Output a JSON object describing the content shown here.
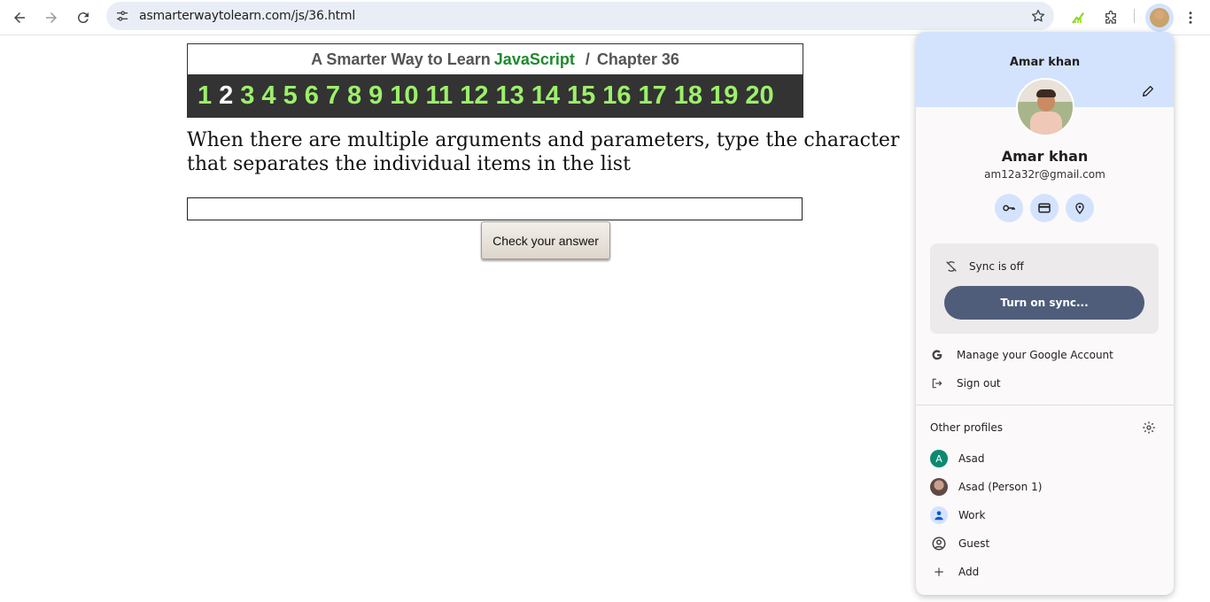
{
  "browser": {
    "url": "asmarterwaytolearn.com/js/36.html",
    "icons": {
      "back": "arrow-left-icon",
      "forward": "arrow-right-icon",
      "reload": "reload-icon",
      "site_info": "tune-icon",
      "bookmark": "star-icon",
      "extension_1": "green-chart-icon",
      "extensions": "puzzle-icon",
      "menu": "three-dots-icon"
    }
  },
  "page": {
    "title_prefix": "A Smarter Way to Learn",
    "title_js": "JavaScript",
    "title_sep": "/",
    "title_chapter": "Chapter 36",
    "numbers": [
      "1",
      "2",
      "3",
      "4",
      "5",
      "6",
      "7",
      "8",
      "9",
      "10",
      "11",
      "12",
      "13",
      "14",
      "15",
      "16",
      "17",
      "18",
      "19",
      "20"
    ],
    "current_number": "2",
    "question": "When there are multiple arguments and parameters, type the character that separates the individual items in the list",
    "answer_value": "",
    "check_button": "Check your answer",
    "colors": {
      "number": "#9cf06a",
      "current_number": "#ffffff",
      "bar_bg": "#333333",
      "js_green": "#1e8a2e"
    }
  },
  "profile_popup": {
    "name_top": "Amar khan",
    "name": "Amar khan",
    "email": "am12a32r@gmail.com",
    "quick_icons": [
      "key-icon",
      "credit-card-icon",
      "location-pin-icon"
    ],
    "sync_status": "Sync is off",
    "sync_button": "Turn on sync...",
    "manage_account": "Manage your Google Account",
    "sign_out": "Sign out",
    "other_profiles_title": "Other profiles",
    "profiles": [
      {
        "name": "Asad",
        "avatar_letter": "A",
        "color": "#0b8a6f"
      },
      {
        "name": "Asad (Person 1)",
        "avatar_letter": "",
        "color": "#6d5a55"
      },
      {
        "name": "Work",
        "avatar_letter": "",
        "color": "#d3e3fd"
      },
      {
        "name": "Guest",
        "avatar_letter": "",
        "color": "#ffffff"
      },
      {
        "name": "Add",
        "avatar_letter": "",
        "color": "#ffffff"
      }
    ],
    "colors": {
      "header_bg": "#d3e3fd",
      "sync_button_bg": "#4f5d7a"
    }
  }
}
